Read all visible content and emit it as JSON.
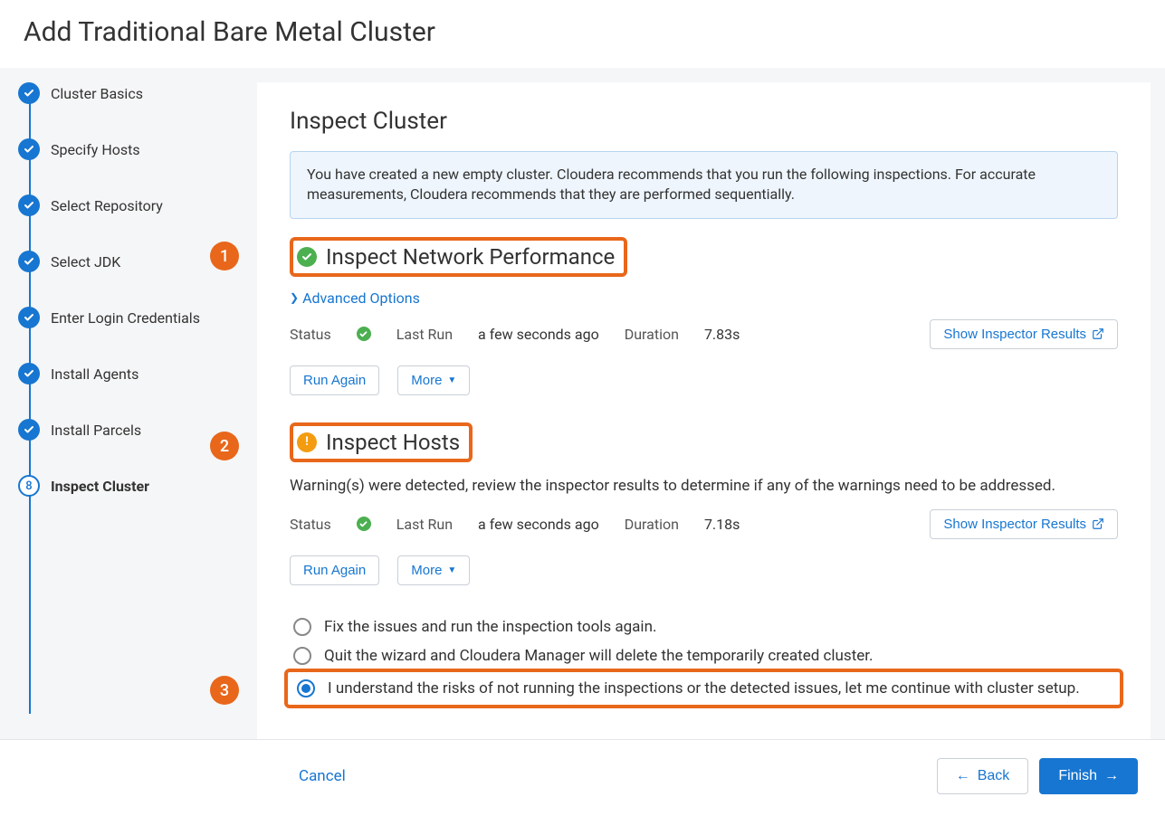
{
  "page_title": "Add Traditional Bare Metal Cluster",
  "stepper": {
    "steps": [
      {
        "label": "Cluster Basics",
        "state": "done"
      },
      {
        "label": "Specify Hosts",
        "state": "done"
      },
      {
        "label": "Select Repository",
        "state": "done"
      },
      {
        "label": "Select JDK",
        "state": "done"
      },
      {
        "label": "Enter Login Credentials",
        "state": "done"
      },
      {
        "label": "Install Agents",
        "state": "done"
      },
      {
        "label": "Install Parcels",
        "state": "done"
      },
      {
        "label": "Inspect Cluster",
        "state": "current",
        "number": "8"
      }
    ]
  },
  "content": {
    "heading": "Inspect Cluster",
    "info": "You have created a new empty cluster. Cloudera recommends that you run the following inspections. For accurate measurements, Cloudera recommends that they are performed sequentially.",
    "sections": [
      {
        "title": "Inspect Network Performance",
        "status": "ok",
        "advanced": "Advanced Options",
        "status_label": "Status",
        "lastrun_label": "Last Run",
        "lastrun_value": "a few seconds ago",
        "duration_label": "Duration",
        "duration_value": "7.83s",
        "inspector_btn": "Show Inspector Results",
        "run_again": "Run Again",
        "more": "More"
      },
      {
        "title": "Inspect Hosts",
        "status": "warn",
        "warning_text": "Warning(s) were detected, review the inspector results to determine if any of the warnings need to be addressed.",
        "status_label": "Status",
        "lastrun_label": "Last Run",
        "lastrun_value": "a few seconds ago",
        "duration_label": "Duration",
        "duration_value": "7.18s",
        "inspector_btn": "Show Inspector Results",
        "run_again": "Run Again",
        "more": "More"
      }
    ],
    "radios": [
      {
        "label": "Fix the issues and run the inspection tools again.",
        "checked": false
      },
      {
        "label": "Quit the wizard and Cloudera Manager will delete the temporarily created cluster.",
        "checked": false
      },
      {
        "label": "I understand the risks of not running the inspections or the detected issues, let me continue with cluster setup.",
        "checked": true
      }
    ],
    "callouts": {
      "one": "1",
      "two": "2",
      "three": "3"
    }
  },
  "footer": {
    "cancel": "Cancel",
    "back": "Back",
    "finish": "Finish"
  }
}
